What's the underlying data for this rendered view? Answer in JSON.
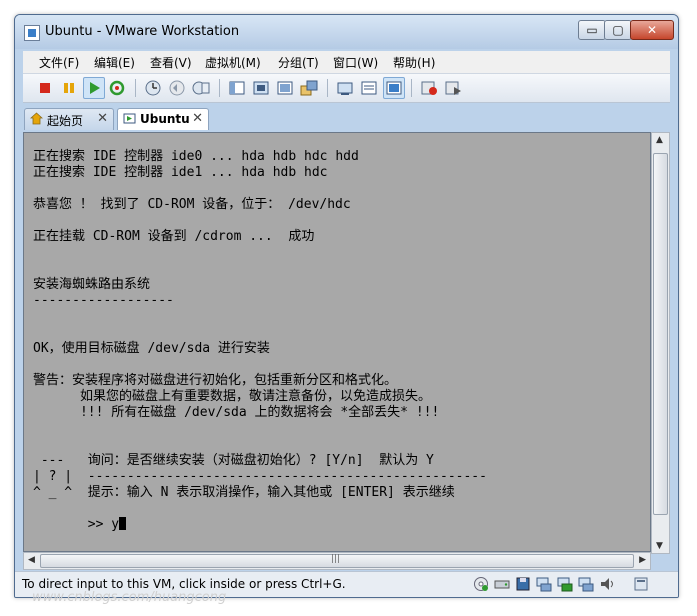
{
  "window": {
    "title": "Ubuntu - VMware Workstation",
    "min_glyph": "▭",
    "max_glyph": "▢",
    "close_glyph": "✕"
  },
  "menubar": {
    "items": [
      "文件(F)",
      "编辑(E)",
      "查看(V)",
      "虚拟机(M)",
      "分组(T)",
      "窗口(W)",
      "帮助(H)"
    ]
  },
  "tabs": [
    {
      "label": "起始页",
      "close": "✕"
    },
    {
      "label": "Ubuntu",
      "close": "✕"
    }
  ],
  "console": {
    "lines": [
      "正在搜索 IDE 控制器 ide0 ... hda hdb hdc hdd",
      "正在搜索 IDE 控制器 ide1 ... hda hdb hdc",
      "恭喜您 ！ 找到了 CD-ROM 设备，位于： /dev/hdc",
      "正在挂载 CD-ROM 设备到 /cdrom ...  成功",
      "安装海蜘蛛路由系统",
      "------------------",
      "OK，使用目标磁盘 /dev/sda 进行安装",
      "警告：安装程序将对磁盘进行初始化，包括重新分区和格式化。",
      "      如果您的磁盘上有重要数据，敬请注意备份，以免造成损失。",
      "      !!! 所有在磁盘 /dev/sda 上的数据将会 *全部丢失* !!!",
      " ---   询问：是否继续安装（对磁盘初始化）? [Y/n]  默认为 Y",
      "| ? |  ---------------------------------------------------",
      "^ _ ^  提示：输入 N 表示取消操作，输入其他或 [ENTER] 表示继续",
      "       >> y"
    ]
  },
  "scroll": {
    "hgrip": "|||"
  },
  "statusbar": {
    "text": "To direct input to this VM, click inside or press Ctrl+G."
  },
  "watermark": "www.cnblogs.com/huangcong",
  "colors": {
    "console_bg": "#a8a8a8",
    "window_frame": "#bcd2ea",
    "accent": "#3a7ec8"
  }
}
